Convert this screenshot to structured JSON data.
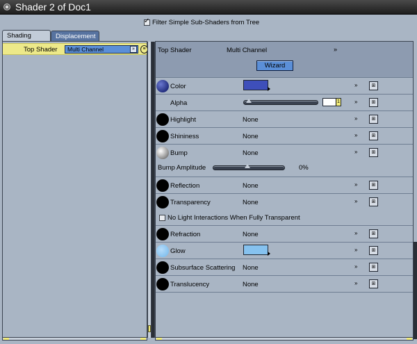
{
  "window": {
    "title": "Shader 2 of Doc1"
  },
  "filter": {
    "label": "Filter Simple Sub-Shaders from Tree",
    "checked": true
  },
  "tabs": [
    {
      "label": "Shading",
      "active": true
    },
    {
      "label": "Displacement",
      "active": false
    }
  ],
  "tree": {
    "top_shader_label": "Top Shader",
    "top_shader_value": "Multi Channel"
  },
  "inspector": {
    "top_shader_label": "Top Shader",
    "top_shader_value": "Multi Channel",
    "chevron": "»",
    "wizard_label": "Wizard",
    "channels": {
      "color": {
        "label": "Color",
        "color": "#3e4fba"
      },
      "alpha": {
        "label": "Alpha",
        "value": "1"
      },
      "highlight": {
        "label": "Highlight",
        "value": "None"
      },
      "shininess": {
        "label": "Shininess",
        "value": "None"
      },
      "bump": {
        "label": "Bump",
        "value": "None"
      },
      "bump_amplitude": {
        "label": "Bump Amplitude",
        "value": "0%"
      },
      "reflection": {
        "label": "Reflection",
        "value": "None"
      },
      "transparency": {
        "label": "Transparency",
        "value": "None"
      },
      "no_light": {
        "label": "No Light Interactions When Fully Transparent",
        "checked": false
      },
      "refraction": {
        "label": "Refraction",
        "value": "None"
      },
      "glow": {
        "label": "Glow",
        "color": "#86c2ef"
      },
      "subsurface": {
        "label": "Subsurface Scattering",
        "value": "None"
      },
      "translucency": {
        "label": "Translucency",
        "value": "None"
      }
    }
  },
  "colors": {
    "selected_row": "#ede989",
    "accent_blue": "#5b8fd8",
    "panel_bg": "#a9b5c4"
  }
}
